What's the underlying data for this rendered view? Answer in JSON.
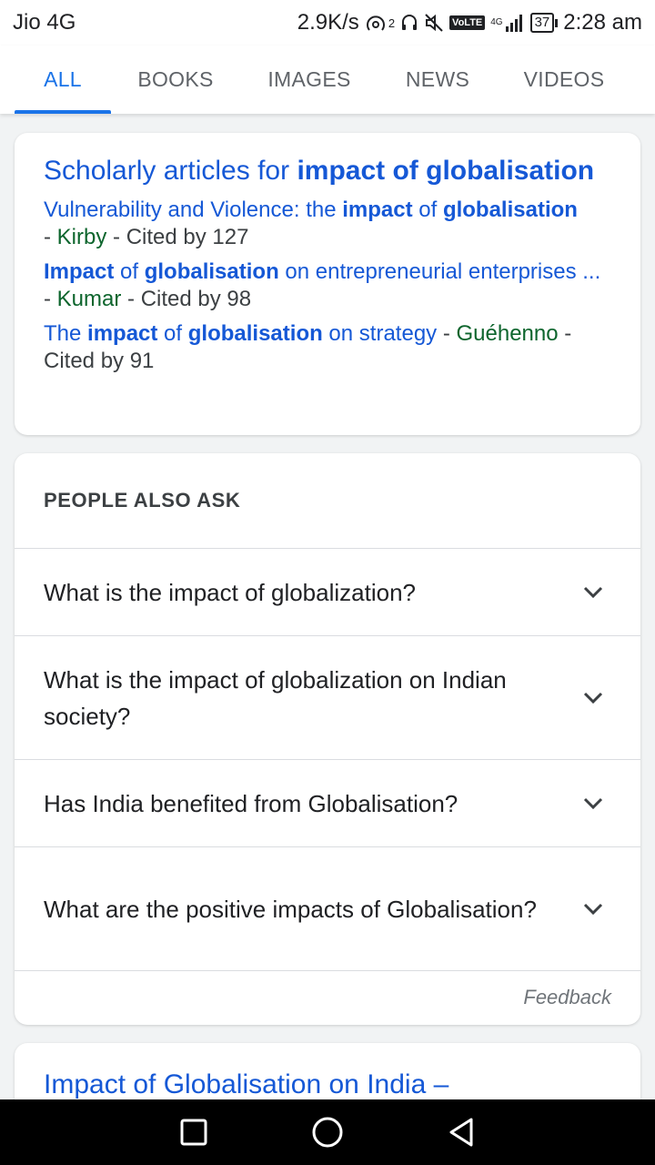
{
  "status_bar": {
    "carrier": "Jio 4G",
    "speed": "2.9K/s",
    "hotspot_sup": "2",
    "volte": "VoLTE",
    "network": "4G",
    "battery": "37",
    "time": "2:28 am"
  },
  "tabs": [
    {
      "label": "ALL",
      "active": true
    },
    {
      "label": "BOOKS",
      "active": false
    },
    {
      "label": "IMAGES",
      "active": false
    },
    {
      "label": "NEWS",
      "active": false
    },
    {
      "label": "VIDEOS",
      "active": false
    }
  ],
  "scholar": {
    "title_prefix": "Scholarly articles for ",
    "title_query": "impact of globalisation",
    "articles": [
      {
        "parts": [
          "Vulnerability and Violence: the ",
          "impact",
          " of ",
          "globalisation"
        ],
        "author": "Kirby",
        "cited": "Cited by 127"
      },
      {
        "parts": [
          "Impact",
          " of ",
          "globalisation",
          " on entrepreneurial enterprises ..."
        ],
        "author": "Kumar",
        "cited": "Cited by 98"
      },
      {
        "parts": [
          "The ",
          "impact",
          " of ",
          "globalisation",
          " on strategy"
        ],
        "author": "Guéhenno",
        "cited": "Cited by 91"
      }
    ]
  },
  "people_also_ask": {
    "heading": "PEOPLE ALSO ASK",
    "questions": [
      "What is the impact of globalization?",
      "What is the impact of globalization on Indian society?",
      "Has India benefited from Globalisation?",
      "What are the positive impacts of Globalisation?"
    ],
    "feedback": "Feedback"
  },
  "next_result": {
    "title": "Impact of Globalisation on India –"
  },
  "colors": {
    "accent": "#1a73e8",
    "link": "#1558d6",
    "author_green": "#0d652d"
  }
}
